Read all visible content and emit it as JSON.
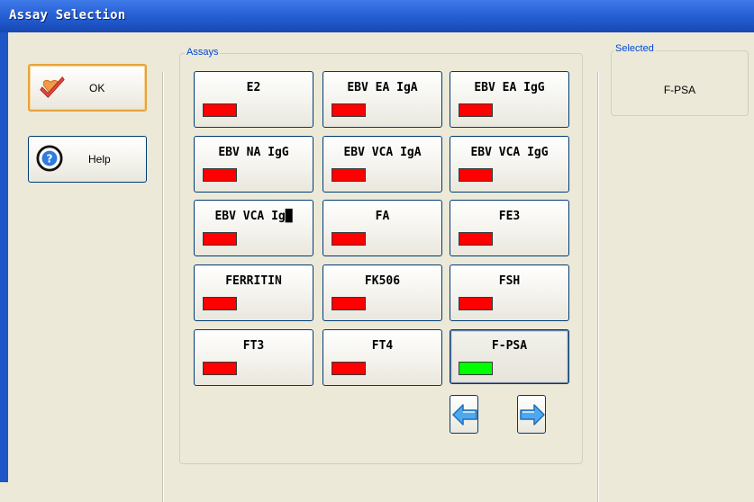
{
  "window": {
    "title": "Assay Selection"
  },
  "sidebar": {
    "ok_label": "OK",
    "help_label": "Help"
  },
  "assays_group": {
    "label": "Assays",
    "items": [
      {
        "name": "E2",
        "status_color": "#FF0000"
      },
      {
        "name": "EBV EA IgA",
        "status_color": "#FF0000"
      },
      {
        "name": "EBV EA IgG",
        "status_color": "#FF0000"
      },
      {
        "name": "EBV NA IgG",
        "status_color": "#FF0000"
      },
      {
        "name": "EBV VCA IgA",
        "status_color": "#FF0000"
      },
      {
        "name": "EBV VCA IgG",
        "status_color": "#FF0000"
      },
      {
        "name": "EBV VCA Ig█",
        "status_color": "#FF0000"
      },
      {
        "name": "FA",
        "status_color": "#FF0000"
      },
      {
        "name": "FE3",
        "status_color": "#FF0000"
      },
      {
        "name": "FERRITIN",
        "status_color": "#FF0000"
      },
      {
        "name": "FK506",
        "status_color": "#FF0000"
      },
      {
        "name": "FSH",
        "status_color": "#FF0000"
      },
      {
        "name": "FT3",
        "status_color": "#FF0000"
      },
      {
        "name": "FT4",
        "status_color": "#FF0000"
      },
      {
        "name": "F-PSA",
        "status_color": "#00FF00",
        "selected": true
      }
    ],
    "prev_icon": "arrow-left-icon",
    "next_icon": "arrow-right-icon"
  },
  "selected_group": {
    "label": "Selected",
    "value": "F-PSA"
  },
  "colors": {
    "title_bar": "#1E56C8",
    "group_label": "#0046D5",
    "not_ready": "#FF0000",
    "ready": "#00FF00",
    "arrow": "#3FA0E8"
  }
}
